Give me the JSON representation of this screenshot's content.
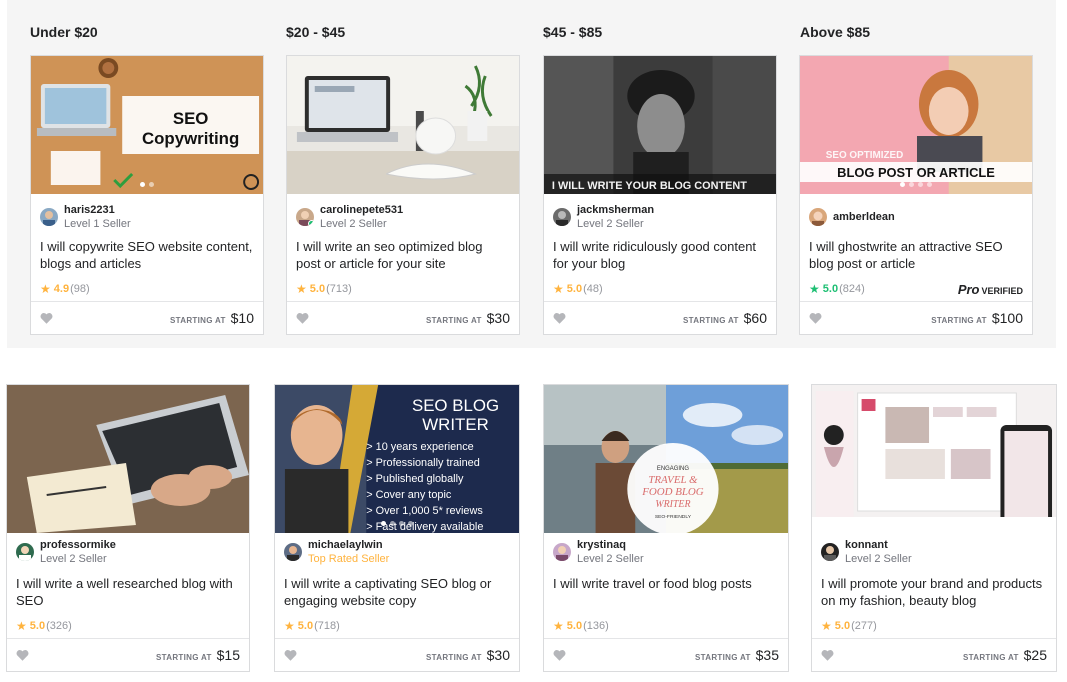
{
  "groups": [
    {
      "heading": "Under $20"
    },
    {
      "heading": "$20 - $45"
    },
    {
      "heading": "$45 - $85"
    },
    {
      "heading": "Above $85"
    }
  ],
  "starting_at_label": "STARTING AT",
  "cards": [
    {
      "seller": "haris2231",
      "level": "Level 1 Seller",
      "title": "I will copywrite SEO website content, blogs and articles",
      "score": "4.9",
      "count": "(98)",
      "price": "$10",
      "image_text": [
        "SEO",
        "Copywriting"
      ]
    },
    {
      "seller": "carolinepete531",
      "level": "Level 2 Seller",
      "title": "I will write an seo optimized blog post or article for your site",
      "score": "5.0",
      "count": "(713)",
      "price": "$30"
    },
    {
      "seller": "jackmsherman",
      "level": "Level 2 Seller",
      "title": "I will write ridiculously good content for your blog",
      "score": "5.0",
      "count": "(48)",
      "price": "$60",
      "image_text": [
        "I WILL WRITE YOUR BLOG CONTENT"
      ]
    },
    {
      "seller": "amberldean",
      "level": "",
      "title": "I will ghostwrite an attractive SEO blog post or article",
      "score": "5.0",
      "count": "(824)",
      "price": "$100",
      "pro_mark": "Pro",
      "pro_label": "VERIFIED",
      "image_text": [
        "SEO OPTIMIZED",
        "BLOG POST OR ARTICLE"
      ]
    },
    {
      "seller": "professormike",
      "level": "Level 2 Seller",
      "title": "I will write a well researched blog with SEO",
      "score": "5.0",
      "count": "(326)",
      "price": "$15"
    },
    {
      "seller": "michaelaylwin",
      "level": "Top Rated Seller",
      "title": "I will write a captivating SEO blog or engaging website copy",
      "score": "5.0",
      "count": "(718)",
      "price": "$30",
      "image_text": [
        "SEO BLOG",
        "WRITER",
        "> 10 years experience",
        "> Professionally trained",
        "> Published globally",
        "> Cover any topic",
        "> Over 1,000 5* reviews",
        "> Fast delivery available"
      ]
    },
    {
      "seller": "krystinaq",
      "level": "Level 2 Seller",
      "title": "I will write travel or food blog posts",
      "score": "5.0",
      "count": "(136)",
      "price": "$35",
      "image_text": [
        "ENGAGING",
        "TRAVEL &",
        "FOOD BLOG",
        "WRITER",
        "SEO-FRIENDLY"
      ]
    },
    {
      "seller": "konnant",
      "level": "Level 2 Seller",
      "title": "I will promote your brand and products on my fashion, beauty blog",
      "score": "5.0",
      "count": "(277)",
      "price": "$25"
    }
  ],
  "colors": {
    "star": "#ffb33e",
    "green": "#1dbf73",
    "top_rated": "#ffb33e",
    "panel_bg": "#f5f5f5",
    "border": "#dadbdd"
  },
  "icons": {
    "heart": "heart-icon",
    "star": "star-icon"
  }
}
